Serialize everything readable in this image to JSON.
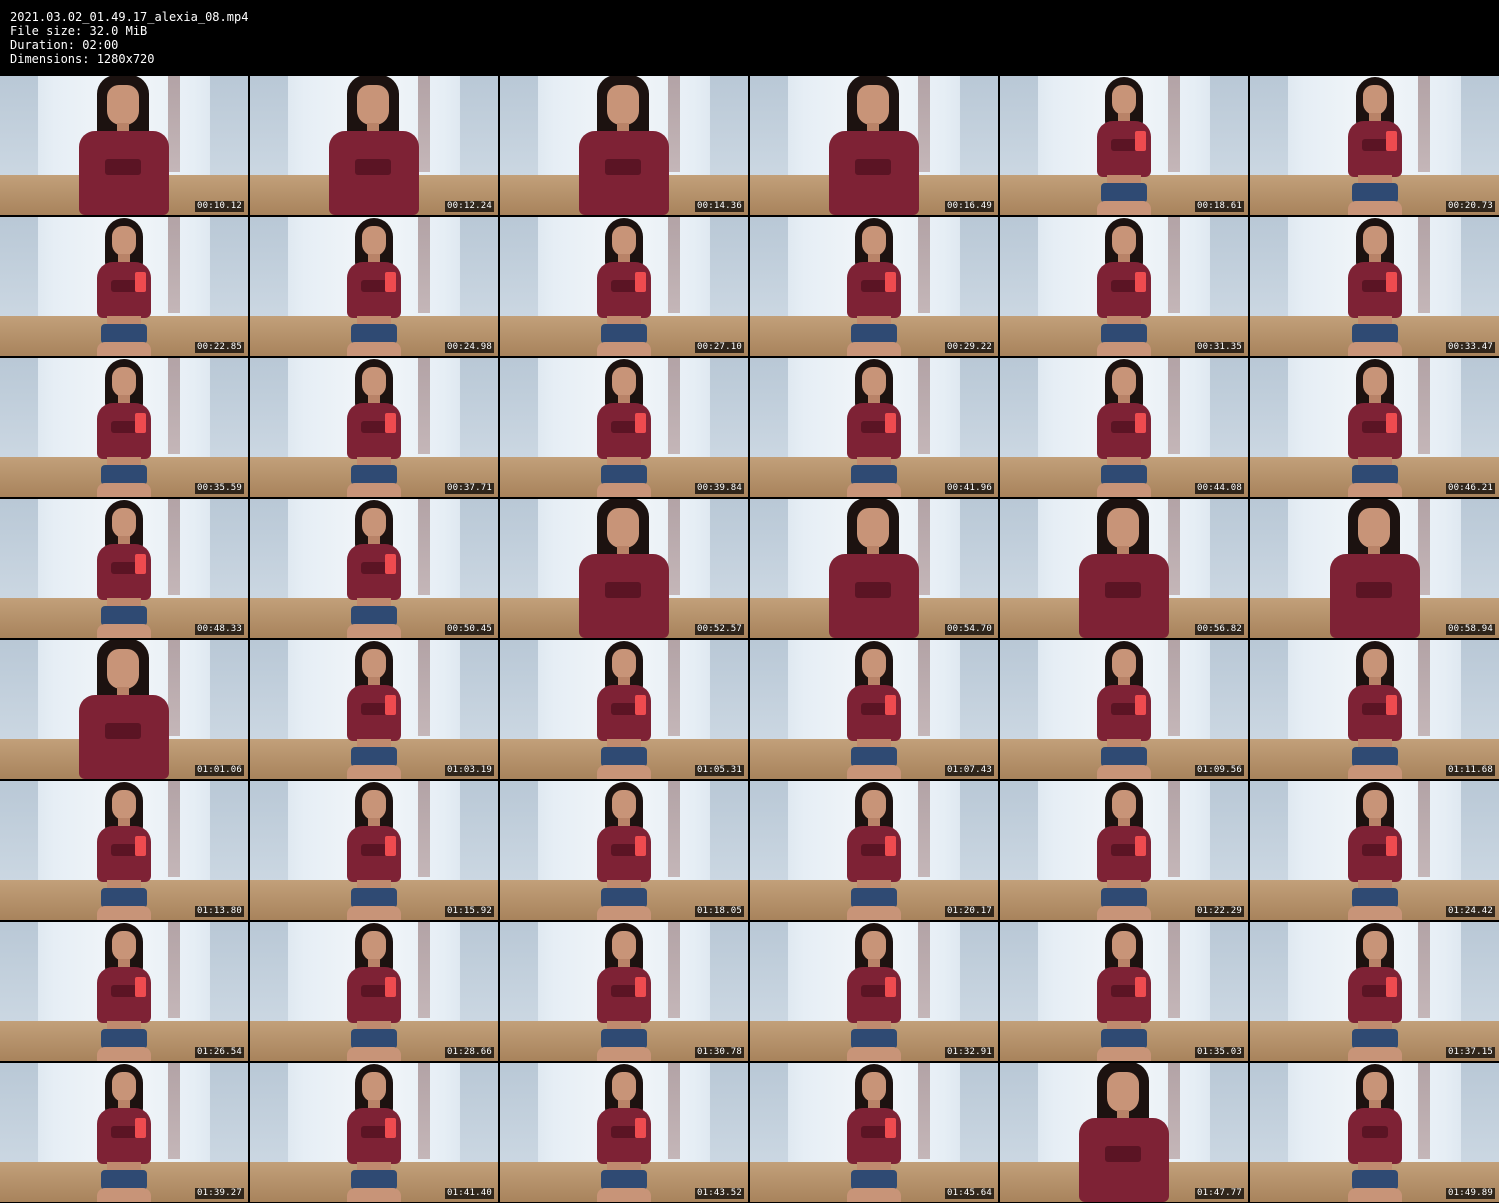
{
  "header": {
    "filename": "2021.03.02_01.49.17_alexia_08.mp4",
    "file_size": "File size: 32.0 MiB",
    "duration": "Duration: 02:00",
    "dimensions": "Dimensions: 1280x720"
  },
  "colors": {
    "background": "#000000",
    "header_text": "#ffffff",
    "timestamp_bg": "#000000",
    "top_color": "#7e2235",
    "shorts_color": "#2f4a73",
    "phone_color": "#ee4b4f"
  },
  "grid": {
    "columns": 6,
    "rows": 8
  },
  "thumbnails": [
    {
      "timestamp": "00:10.12",
      "framing": "close",
      "phone": false
    },
    {
      "timestamp": "00:12.24",
      "framing": "close",
      "phone": false
    },
    {
      "timestamp": "00:14.36",
      "framing": "close",
      "phone": false
    },
    {
      "timestamp": "00:16.49",
      "framing": "close",
      "phone": false
    },
    {
      "timestamp": "00:18.61",
      "framing": "seated",
      "phone": true
    },
    {
      "timestamp": "00:20.73",
      "framing": "seated",
      "phone": true
    },
    {
      "timestamp": "00:22.85",
      "framing": "seated",
      "phone": true
    },
    {
      "timestamp": "00:24.98",
      "framing": "seated",
      "phone": true
    },
    {
      "timestamp": "00:27.10",
      "framing": "seated",
      "phone": true
    },
    {
      "timestamp": "00:29.22",
      "framing": "seated",
      "phone": true
    },
    {
      "timestamp": "00:31.35",
      "framing": "seated",
      "phone": true
    },
    {
      "timestamp": "00:33.47",
      "framing": "seated",
      "phone": true
    },
    {
      "timestamp": "00:35.59",
      "framing": "seated",
      "phone": true
    },
    {
      "timestamp": "00:37.71",
      "framing": "seated",
      "phone": true
    },
    {
      "timestamp": "00:39.84",
      "framing": "seated",
      "phone": true
    },
    {
      "timestamp": "00:41.96",
      "framing": "seated",
      "phone": true
    },
    {
      "timestamp": "00:44.08",
      "framing": "seated",
      "phone": true
    },
    {
      "timestamp": "00:46.21",
      "framing": "seated",
      "phone": true
    },
    {
      "timestamp": "00:48.33",
      "framing": "seated",
      "phone": true
    },
    {
      "timestamp": "00:50.45",
      "framing": "seated",
      "phone": true
    },
    {
      "timestamp": "00:52.57",
      "framing": "close",
      "phone": false
    },
    {
      "timestamp": "00:54.70",
      "framing": "close",
      "phone": false
    },
    {
      "timestamp": "00:56.82",
      "framing": "close",
      "phone": false
    },
    {
      "timestamp": "00:58.94",
      "framing": "close",
      "phone": false
    },
    {
      "timestamp": "01:01.06",
      "framing": "close",
      "phone": false
    },
    {
      "timestamp": "01:03.19",
      "framing": "seated",
      "phone": true
    },
    {
      "timestamp": "01:05.31",
      "framing": "seated",
      "phone": true
    },
    {
      "timestamp": "01:07.43",
      "framing": "seated",
      "phone": true
    },
    {
      "timestamp": "01:09.56",
      "framing": "seated",
      "phone": true
    },
    {
      "timestamp": "01:11.68",
      "framing": "seated",
      "phone": true
    },
    {
      "timestamp": "01:13.80",
      "framing": "seated",
      "phone": true
    },
    {
      "timestamp": "01:15.92",
      "framing": "seated",
      "phone": true
    },
    {
      "timestamp": "01:18.05",
      "framing": "seated",
      "phone": true
    },
    {
      "timestamp": "01:20.17",
      "framing": "seated",
      "phone": true
    },
    {
      "timestamp": "01:22.29",
      "framing": "seated",
      "phone": true
    },
    {
      "timestamp": "01:24.42",
      "framing": "seated",
      "phone": true
    },
    {
      "timestamp": "01:26.54",
      "framing": "seated",
      "phone": true
    },
    {
      "timestamp": "01:28.66",
      "framing": "seated",
      "phone": true
    },
    {
      "timestamp": "01:30.78",
      "framing": "seated",
      "phone": true
    },
    {
      "timestamp": "01:32.91",
      "framing": "seated",
      "phone": true
    },
    {
      "timestamp": "01:35.03",
      "framing": "seated",
      "phone": true
    },
    {
      "timestamp": "01:37.15",
      "framing": "seated",
      "phone": true
    },
    {
      "timestamp": "01:39.27",
      "framing": "seated",
      "phone": true
    },
    {
      "timestamp": "01:41.40",
      "framing": "seated",
      "phone": true
    },
    {
      "timestamp": "01:43.52",
      "framing": "seated",
      "phone": true
    },
    {
      "timestamp": "01:45.64",
      "framing": "seated",
      "phone": true
    },
    {
      "timestamp": "01:47.77",
      "framing": "close",
      "phone": false
    },
    {
      "timestamp": "01:49.89",
      "framing": "seated",
      "phone": false
    }
  ]
}
